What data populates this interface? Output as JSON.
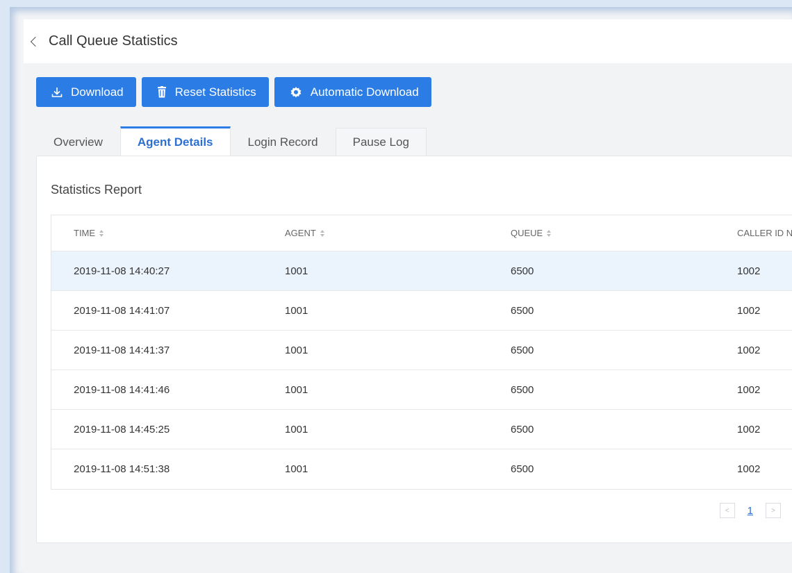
{
  "header": {
    "title": "Call Queue Statistics"
  },
  "toolbar": {
    "download_label": "Download",
    "reset_label": "Reset Statistics",
    "auto_download_label": "Automatic Download"
  },
  "tabs": [
    {
      "label": "Overview",
      "active": false
    },
    {
      "label": "Agent Details",
      "active": true
    },
    {
      "label": "Login Record",
      "active": false
    },
    {
      "label": "Pause Log",
      "active": false
    }
  ],
  "report": {
    "title": "Statistics Report",
    "columns": [
      "TIME",
      "AGENT",
      "QUEUE",
      "CALLER ID NU"
    ],
    "rows": [
      [
        "2019-11-08 14:40:27",
        "1001",
        "6500",
        "1002"
      ],
      [
        "2019-11-08 14:41:07",
        "1001",
        "6500",
        "1002"
      ],
      [
        "2019-11-08 14:41:37",
        "1001",
        "6500",
        "1002"
      ],
      [
        "2019-11-08 14:41:46",
        "1001",
        "6500",
        "1002"
      ],
      [
        "2019-11-08 14:45:25",
        "1001",
        "6500",
        "1002"
      ],
      [
        "2019-11-08 14:51:38",
        "1001",
        "6500",
        "1002"
      ]
    ]
  },
  "pagination": {
    "prev": "<",
    "current_page": "1",
    "next": ">"
  },
  "colors": {
    "accent": "#2b7ce5",
    "row_highlight": "#ebf3fd"
  }
}
